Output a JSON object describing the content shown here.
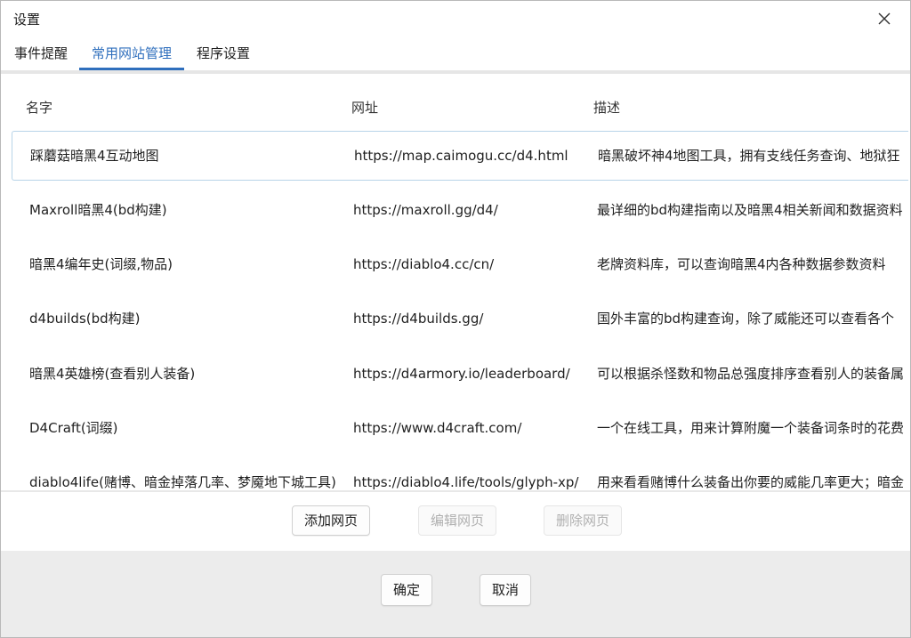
{
  "window": {
    "title": "设置"
  },
  "tabs": [
    {
      "label": "事件提醒",
      "active": false
    },
    {
      "label": "常用网站管理",
      "active": true
    },
    {
      "label": "程序设置",
      "active": false
    }
  ],
  "table": {
    "headers": {
      "name": "名字",
      "url": "网址",
      "desc": "描述"
    },
    "rows": [
      {
        "name": "踩蘑菇暗黑4互动地图",
        "url": "https://map.caimogu.cc/d4.html",
        "desc": "暗黑破坏神4地图工具，拥有支线任务查询、地狱狂"
      },
      {
        "name": "Maxroll暗黑4(bd构建)",
        "url": "https://maxroll.gg/d4/",
        "desc": "最详细的bd构建指南以及暗黑4相关新闻和数据资料"
      },
      {
        "name": "暗黑4编年史(词缀,物品)",
        "url": "https://diablo4.cc/cn/",
        "desc": "老牌资料库，可以查询暗黑4内各种数据参数资料"
      },
      {
        "name": "d4builds(bd构建)",
        "url": "https://d4builds.gg/",
        "desc": "国外丰富的bd构建查询，除了威能还可以查看各个"
      },
      {
        "name": "暗黑4英雄榜(查看别人装备)",
        "url": "https://d4armory.io/leaderboard/",
        "desc": "可以根据杀怪数和物品总强度排序查看别人的装备属"
      },
      {
        "name": "D4Craft(词缀)",
        "url": "https://www.d4craft.com/",
        "desc": "一个在线工具，用来计算附魔一个装备词条时的花费"
      },
      {
        "name": "diablo4life(赌博、暗金掉落几率、梦魇地下城工具)",
        "url": "https://diablo4.life/tools/glyph-xp/",
        "desc": "用来看看赌博什么装备出你要的威能几率更大；暗金"
      }
    ],
    "selected_index": 0
  },
  "actions": {
    "add_label": "添加网页",
    "edit_label": "编辑网页",
    "delete_label": "删除网页"
  },
  "footer": {
    "ok_label": "确定",
    "cancel_label": "取消"
  },
  "colors": {
    "accent": "#2f6fbd",
    "selected_border": "#b8d4e8",
    "footer_bg": "#ececec"
  },
  "icons": {
    "close": "close-icon"
  }
}
